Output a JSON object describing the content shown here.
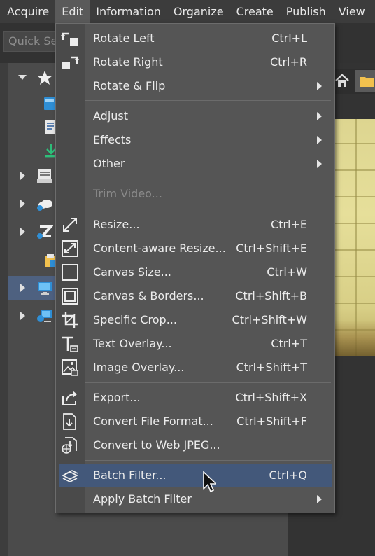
{
  "menubar": {
    "items": [
      "Acquire",
      "Edit",
      "Information",
      "Organize",
      "Create",
      "Publish",
      "View"
    ],
    "active": "Edit"
  },
  "toolbar": {
    "quick_search_placeholder": "Quick Se"
  },
  "edit_menu": {
    "items": [
      {
        "label": "Rotate Left",
        "shortcut": "Ctrl+L",
        "icon": "rotate-left-icon"
      },
      {
        "label": "Rotate Right",
        "shortcut": "Ctrl+R",
        "icon": "rotate-right-icon"
      },
      {
        "label": "Rotate & Flip",
        "submenu": true
      },
      {
        "label": "Adjust",
        "submenu": true
      },
      {
        "label": "Effects",
        "submenu": true
      },
      {
        "label": "Other",
        "submenu": true
      },
      {
        "label": "Trim Video...",
        "disabled": true
      },
      {
        "label": "Resize...",
        "shortcut": "Ctrl+E",
        "icon": "resize-icon"
      },
      {
        "label": "Content-aware Resize...",
        "shortcut": "Ctrl+Shift+E",
        "icon": "content-aware-resize-icon"
      },
      {
        "label": "Canvas Size...",
        "shortcut": "Ctrl+W",
        "icon": "canvas-size-icon"
      },
      {
        "label": "Canvas & Borders...",
        "shortcut": "Ctrl+Shift+B",
        "icon": "canvas-borders-icon"
      },
      {
        "label": "Specific Crop...",
        "shortcut": "Ctrl+Shift+W",
        "icon": "crop-icon"
      },
      {
        "label": "Text Overlay...",
        "shortcut": "Ctrl+T",
        "icon": "text-overlay-icon"
      },
      {
        "label": "Image Overlay...",
        "shortcut": "Ctrl+Shift+T",
        "icon": "image-overlay-icon"
      },
      {
        "label": "Export...",
        "shortcut": "Ctrl+Shift+X",
        "icon": "export-icon"
      },
      {
        "label": "Convert File Format...",
        "shortcut": "Ctrl+Shift+F",
        "icon": "convert-format-icon"
      },
      {
        "label": "Convert to Web JPEG...",
        "icon": "web-jpeg-icon"
      },
      {
        "label": "Batch Filter...",
        "shortcut": "Ctrl+Q",
        "icon": "batch-filter-icon",
        "highlighted": true
      },
      {
        "label": "Apply Batch Filter",
        "submenu": true
      }
    ]
  },
  "colors": {
    "menu_bg": "#555555",
    "highlight": "#43587a",
    "accent_blue": "#3aa0e0",
    "accent_green": "#3cb371"
  }
}
